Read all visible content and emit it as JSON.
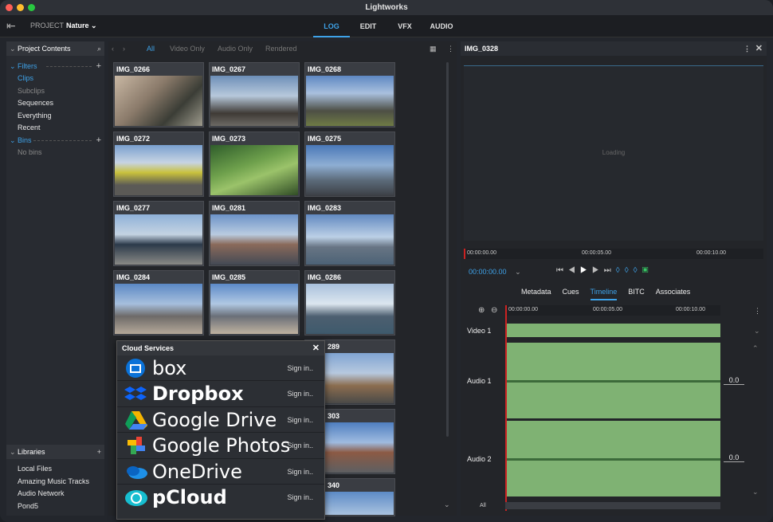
{
  "window": {
    "title": "Lightworks"
  },
  "topbar": {
    "project_label": "PROJECT",
    "project_name": "Nature ⌄",
    "tabs": [
      "LOG",
      "EDIT",
      "VFX",
      "AUDIO"
    ],
    "active_tab": "LOG"
  },
  "sidebar": {
    "header": "Project Contents",
    "filters_label": "Filters",
    "filters": [
      "Clips",
      "Subclips",
      "Sequences",
      "Everything",
      "Recent"
    ],
    "bins_label": "Bins",
    "bins_empty": "No bins",
    "libraries_label": "Libraries",
    "libraries": [
      "Local Files",
      "Amazing Music Tracks",
      "Audio Network",
      "Pond5"
    ]
  },
  "content": {
    "filter_tabs": [
      "All",
      "Video Only",
      "Audio Only",
      "Rendered"
    ],
    "tiles": [
      "IMG_0266",
      "IMG_0267",
      "IMG_0268",
      "IMG_0272",
      "IMG_0273",
      "IMG_0275",
      "IMG_0277",
      "IMG_0281",
      "IMG_0283",
      "IMG_0284",
      "IMG_0285",
      "IMG_0286"
    ],
    "hidden_tiles": [
      "289",
      "303",
      "340"
    ]
  },
  "cloud": {
    "title": "Cloud Services",
    "services": [
      {
        "name": "box",
        "action": "Sign in.."
      },
      {
        "name": "Dropbox",
        "action": "Sign in.."
      },
      {
        "name": "Google Drive",
        "action": "Sign in.."
      },
      {
        "name": "Google Photos",
        "action": "Sign in.."
      },
      {
        "name": "OneDrive",
        "action": "Sign in.."
      },
      {
        "name": "pCloud",
        "action": "Sign in.."
      }
    ]
  },
  "viewer": {
    "clip": "IMG_0328",
    "loading": "Loading",
    "ruler": [
      "00:00:00.00",
      "00:00:05.00",
      "00:00:10.00"
    ],
    "timecode": "00:00:00.00",
    "tabs": [
      "Metadata",
      "Cues",
      "Timeline",
      "BITC",
      "Associates"
    ],
    "active_tab": "Timeline",
    "tl_ruler": [
      "00:00:00.00",
      "00:00:05.00",
      "00:00:10.00"
    ],
    "tracks": [
      {
        "name": "Video 1"
      },
      {
        "name": "Audio 1",
        "level": "0.0"
      },
      {
        "name": "Audio 2",
        "level": "0.0"
      }
    ],
    "all_label": "All"
  }
}
